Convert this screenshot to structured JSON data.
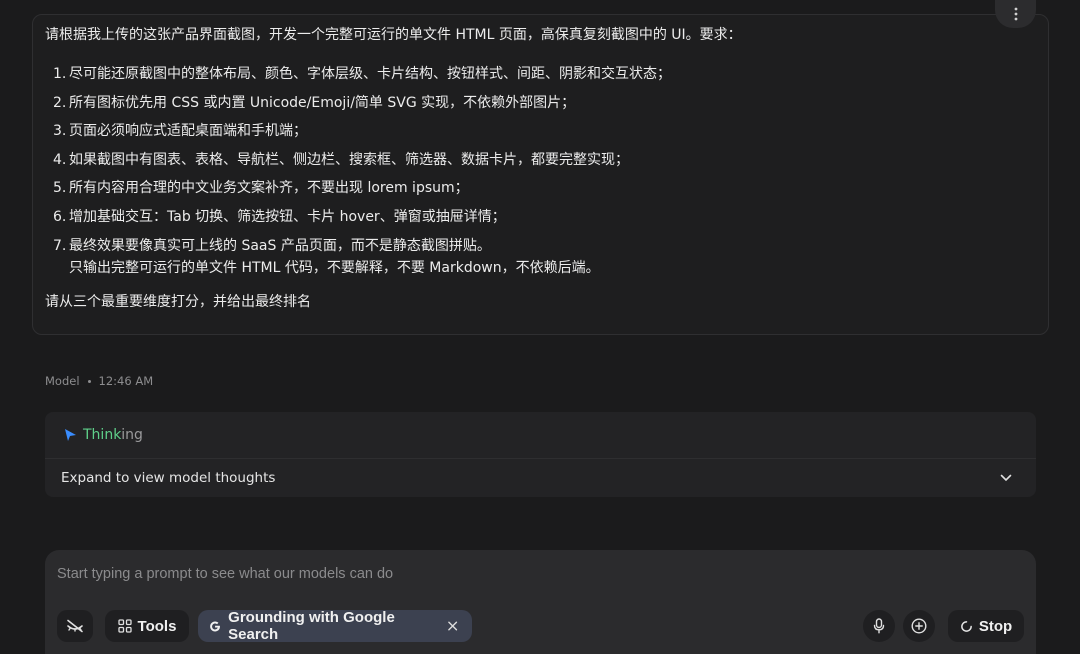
{
  "user_prompt": {
    "intro": "请根据我上传的这张产品界面截图，开发一个完整可运行的单文件 HTML 页面，高保真复刻截图中的 UI。要求：",
    "requirements": [
      {
        "num": "1.",
        "text": "尽可能还原截图中的整体布局、颜色、字体层级、卡片结构、按钮样式、间距、阴影和交互状态；"
      },
      {
        "num": "2.",
        "text": "所有图标优先用 CSS 或内置 Unicode/Emoji/简单 SVG 实现，不依赖外部图片；"
      },
      {
        "num": "3.",
        "text": "页面必须响应式适配桌面端和手机端；"
      },
      {
        "num": "4.",
        "text": "如果截图中有图表、表格、导航栏、侧边栏、搜索框、筛选器、数据卡片，都要完整实现；"
      },
      {
        "num": "5.",
        "text": "所有内容用合理的中文业务文案补齐，不要出现 lorem ipsum；"
      },
      {
        "num": "6.",
        "text": "增加基础交互：Tab 切换、筛选按钮、卡片 hover、弹窗或抽屉详情；"
      },
      {
        "num": "7.",
        "text": "最终效果要像真实可上线的 SaaS 产品页面，而不是静态截图拼贴。",
        "sub": "只输出完整可运行的单文件 HTML 代码，不要解释，不要 Markdown，不依赖后端。"
      }
    ],
    "outro": "请从三个最重要维度打分，并给出最终排名"
  },
  "more_menu_icon": "vertical-dots-icon",
  "model_meta": {
    "author": "Model",
    "time": "12:46 AM"
  },
  "thinking": {
    "label_strong": "Think",
    "label_fade": "ing",
    "expand_text": "Expand to view model thoughts",
    "accent": "#5fd08a"
  },
  "composer": {
    "placeholder": "Start typing a prompt to see what our models can do",
    "tools_label": "Tools",
    "grounding_label": "Grounding with Google Search",
    "stop_label": "Stop"
  },
  "colors": {
    "background": "#1b1b1c",
    "card": "#1e1e1f",
    "composer": "#2b2b2d",
    "grounding_chip": "#3c4150"
  }
}
